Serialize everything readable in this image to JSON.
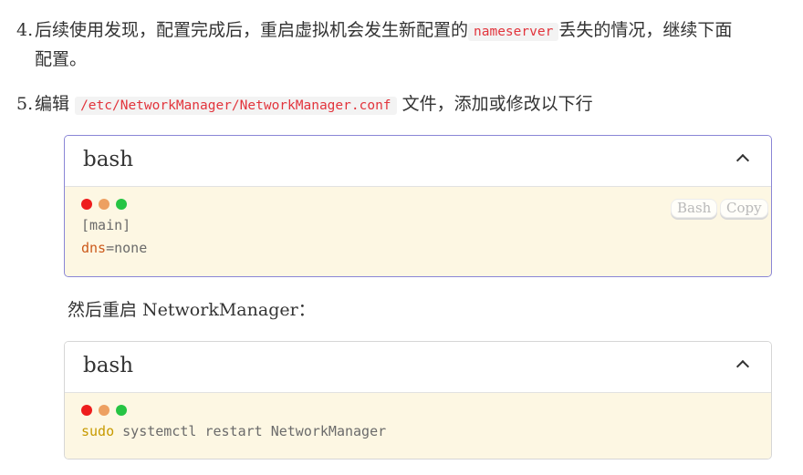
{
  "steps": [
    {
      "num": "4.",
      "line1_before": "后续使用发现，配置完成后，重启虚拟机会发生新配置的",
      "line1_code": "nameserver",
      "line1_after": "丢失的情况，继续下面",
      "line2": "配置。"
    },
    {
      "num": "5.",
      "before": "编辑",
      "code": "/etc/NetworkManager/NetworkManager.conf",
      "after": "文件，添加或修改以下行"
    }
  ],
  "code_blocks": [
    {
      "title": "bash",
      "lang_label": "Bash",
      "copy_label": "Copy",
      "lines": [
        {
          "plain": "[main]"
        },
        {
          "key": "dns",
          "rest": "=none"
        }
      ]
    },
    {
      "title": "bash",
      "lines": [
        {
          "cmd": "sudo",
          "rest": " systemctl restart NetworkManager"
        }
      ]
    }
  ],
  "paragraph": "然后重启 NetworkManager：",
  "colors": {
    "inline_code": "#e2343c",
    "code_bg": "#fdf7e3",
    "active_border": "#8a86d6",
    "dot_red": "#ee1d1d",
    "dot_orange": "#eda061",
    "dot_green": "#26c443"
  }
}
